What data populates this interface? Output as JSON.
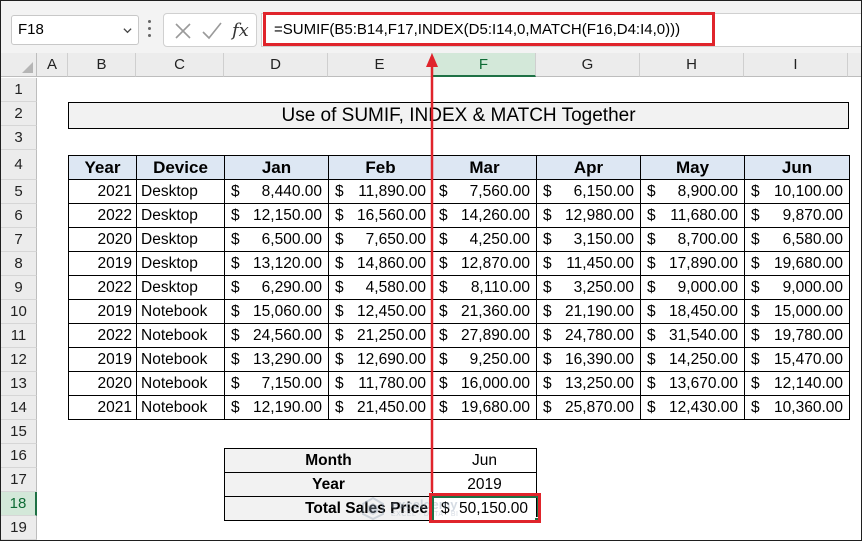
{
  "name_box": "F18",
  "formula": "=SUMIF(B5:B14,F17,INDEX(D5:I14,0,MATCH(F16,D4:I4,0)))",
  "fx_label": "fx",
  "columns": [
    "A",
    "B",
    "C",
    "D",
    "E",
    "F",
    "G",
    "H",
    "I"
  ],
  "rows": [
    "1",
    "2",
    "3",
    "4",
    "5",
    "6",
    "7",
    "8",
    "9",
    "10",
    "11",
    "12",
    "13",
    "14",
    "15",
    "16",
    "17",
    "18",
    "19"
  ],
  "selected_column": "F",
  "selected_row": "18",
  "title": "Use of SUMIF, INDEX & MATCH Together",
  "table": {
    "headers": [
      "Year",
      "Device",
      "Jan",
      "Feb",
      "Mar",
      "Apr",
      "May",
      "Jun"
    ],
    "currency": "$",
    "rows": [
      [
        "2021",
        "Desktop",
        "8,440.00",
        "11,890.00",
        "7,560.00",
        "6,150.00",
        "8,900.00",
        "10,100.00"
      ],
      [
        "2022",
        "Desktop",
        "12,150.00",
        "16,560.00",
        "14,260.00",
        "12,980.00",
        "11,680.00",
        "9,870.00"
      ],
      [
        "2020",
        "Desktop",
        "6,500.00",
        "7,650.00",
        "4,250.00",
        "3,150.00",
        "8,700.00",
        "6,580.00"
      ],
      [
        "2019",
        "Desktop",
        "13,120.00",
        "14,860.00",
        "12,870.00",
        "11,450.00",
        "17,890.00",
        "19,680.00"
      ],
      [
        "2022",
        "Desktop",
        "6,290.00",
        "4,580.00",
        "8,110.00",
        "3,250.00",
        "9,000.00",
        "9,000.00"
      ],
      [
        "2019",
        "Notebook",
        "15,060.00",
        "12,450.00",
        "21,360.00",
        "21,190.00",
        "18,450.00",
        "15,000.00"
      ],
      [
        "2022",
        "Notebook",
        "24,560.00",
        "21,250.00",
        "27,890.00",
        "24,780.00",
        "31,540.00",
        "19,780.00"
      ],
      [
        "2019",
        "Notebook",
        "13,290.00",
        "12,690.00",
        "9,250.00",
        "16,390.00",
        "14,250.00",
        "15,470.00"
      ],
      [
        "2020",
        "Notebook",
        "7,150.00",
        "11,780.00",
        "16,000.00",
        "13,250.00",
        "13,670.00",
        "12,140.00"
      ],
      [
        "2021",
        "Notebook",
        "12,190.00",
        "21,450.00",
        "19,680.00",
        "25,870.00",
        "12,430.00",
        "10,360.00"
      ]
    ]
  },
  "lookup": {
    "month_label": "Month",
    "month_value": "Jun",
    "year_label": "Year",
    "year_value": "2019",
    "total_label": "Total Sales Price",
    "total_currency": "$",
    "total_value": "50,150.00"
  },
  "watermark": {
    "name": "exceldemy",
    "sub": "EXCEL · DATA · BI"
  },
  "colors": {
    "highlight": "#e0242b",
    "selection": "#1e7145",
    "header_fill": "#dde7f3"
  }
}
